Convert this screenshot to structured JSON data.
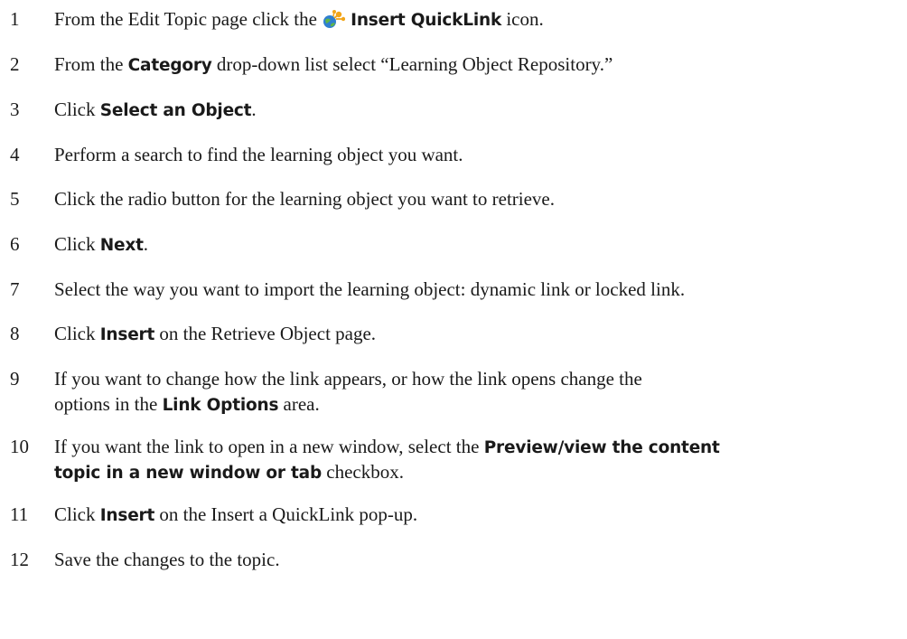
{
  "steps": [
    {
      "num": "1",
      "parts": [
        "From the Edit Topic page click the ",
        "",
        "Insert QuickLink",
        " icon."
      ]
    },
    {
      "num": "2",
      "parts": [
        "From the ",
        "Category",
        " drop-down list select “Learning Object Repository.”"
      ]
    },
    {
      "num": "3",
      "parts": [
        "Click ",
        "Select an Object",
        "."
      ]
    },
    {
      "num": "4",
      "parts": [
        "Perform a search to find the learning object you want."
      ]
    },
    {
      "num": "5",
      "parts": [
        "Click the radio button for the learning object you want to retrieve."
      ]
    },
    {
      "num": "6",
      "parts": [
        "Click ",
        "Next",
        "."
      ]
    },
    {
      "num": "7",
      "parts": [
        "Select the way you want to import the learning object: dynamic link or locked link."
      ]
    },
    {
      "num": "8",
      "parts": [
        "Click ",
        "Insert",
        " on the Retrieve Object page."
      ]
    },
    {
      "num": "9",
      "line1": "If you want to change how the link appears, or how the link opens change the",
      "line2": [
        "options in the ",
        "Link Options",
        " area."
      ]
    },
    {
      "num": "10",
      "line1": [
        "If you want the link to open in a new window, select the ",
        "Preview/view the content"
      ],
      "line2": [
        "topic in a new window or tab",
        " checkbox."
      ]
    },
    {
      "num": "11",
      "parts": [
        "Click ",
        "Insert",
        " on the Insert a QuickLink pop-up."
      ]
    },
    {
      "num": "12",
      "parts": [
        "Save the changes to the topic."
      ]
    }
  ],
  "icons": {
    "quicklink": "insert-quicklink-icon"
  }
}
